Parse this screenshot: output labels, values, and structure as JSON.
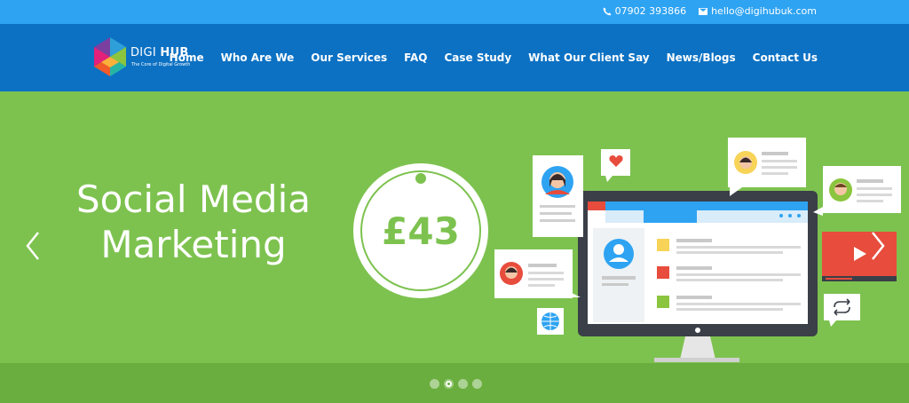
{
  "topbar": {
    "phone": "07902 393866",
    "email": "hello@digihubuk.com",
    "phone_icon": "phone-icon",
    "email_icon": "envelope-icon"
  },
  "logo": {
    "brand_light": "DIGI ",
    "brand_bold": "HUB",
    "tagline": "The Core of Digital Growth"
  },
  "nav": {
    "items": [
      {
        "label": "Home"
      },
      {
        "label": "Who Are We"
      },
      {
        "label": "Our Services"
      },
      {
        "label": "FAQ"
      },
      {
        "label": "Case Study"
      },
      {
        "label": "What Our Client Say"
      },
      {
        "label": "News/Blogs"
      },
      {
        "label": "Contact Us"
      }
    ]
  },
  "hero": {
    "title_line1": "Social Media",
    "title_line2": "Marketing",
    "price": "£43",
    "prev_icon": "chevron-left-icon",
    "next_icon": "chevron-right-icon"
  },
  "slider": {
    "slide_count": 4,
    "active_slide": 2
  },
  "colors": {
    "topbar": "#2ea3f2",
    "header": "#0c71c3",
    "hero": "#7dc24f",
    "band": "#6aae3f"
  }
}
